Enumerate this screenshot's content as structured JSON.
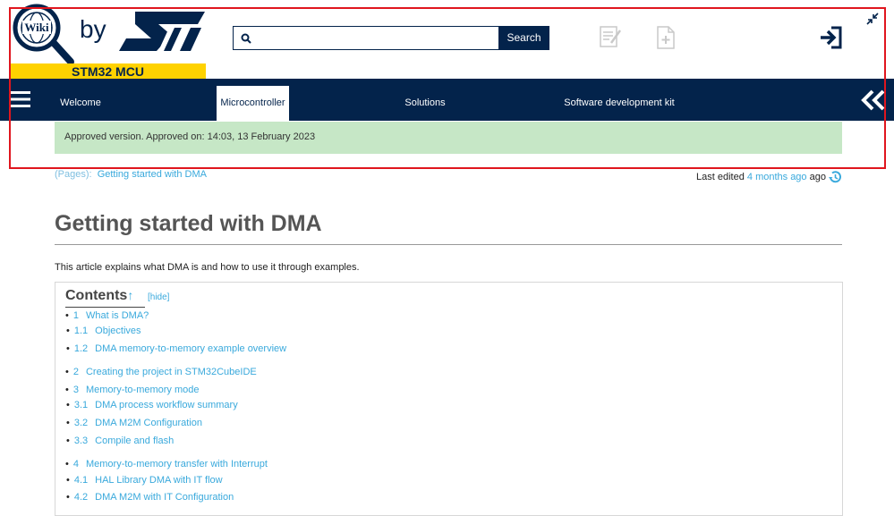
{
  "header": {
    "logo_wiki": "Wiki",
    "by": "by",
    "brand_band": "STM32 MCU",
    "search_placeholder": "",
    "search_button": "Search",
    "icons": [
      "edit-page-icon",
      "new-page-icon",
      "login-icon",
      "collapse-icon"
    ]
  },
  "nav": {
    "items": [
      {
        "label": "Welcome"
      },
      {
        "label": "Microcontroller"
      },
      {
        "label": "Solutions"
      },
      {
        "label": "Software development kit"
      }
    ],
    "active": "Microcontroller"
  },
  "notice": "Approved version. Approved on: 14:03, 13 February 2023",
  "breadcrumb": {
    "prefix": "(Pages):",
    "page": "Getting started with DMA"
  },
  "last_edited": {
    "prefix": "Last edited",
    "link": "4 months ago",
    "suffix": "ago"
  },
  "page_title": "Getting started with DMA",
  "intro": "This article explains what DMA is and how to use it through examples.",
  "toc": {
    "title": "Contents",
    "arrow": "↑",
    "hide": "[hide]",
    "items": [
      {
        "num": "1",
        "label": "What is DMA?"
      },
      {
        "num": "1.1",
        "label": "Objectives"
      },
      {
        "num": "1.2",
        "label": "DMA memory-to-memory example overview"
      },
      {
        "num": "2",
        "label": "Creating the project in STM32CubeIDE"
      },
      {
        "num": "3",
        "label": "Memory-to-memory mode"
      },
      {
        "num": "3.1",
        "label": "DMA process workflow summary"
      },
      {
        "num": "3.2",
        "label": "DMA M2M Configuration"
      },
      {
        "num": "3.3",
        "label": "Compile and flash"
      },
      {
        "num": "4",
        "label": "Memory-to-memory transfer with Interrupt"
      },
      {
        "num": "4.1",
        "label": "HAL Library DMA with IT flow"
      },
      {
        "num": "4.2",
        "label": "DMA M2M with IT Configuration"
      }
    ]
  },
  "colors": {
    "navy": "#03234b",
    "yellow": "#ffd200",
    "link": "#39a9dc",
    "notice_bg": "#c6e7c6",
    "annotation_red": "#e0161e"
  }
}
